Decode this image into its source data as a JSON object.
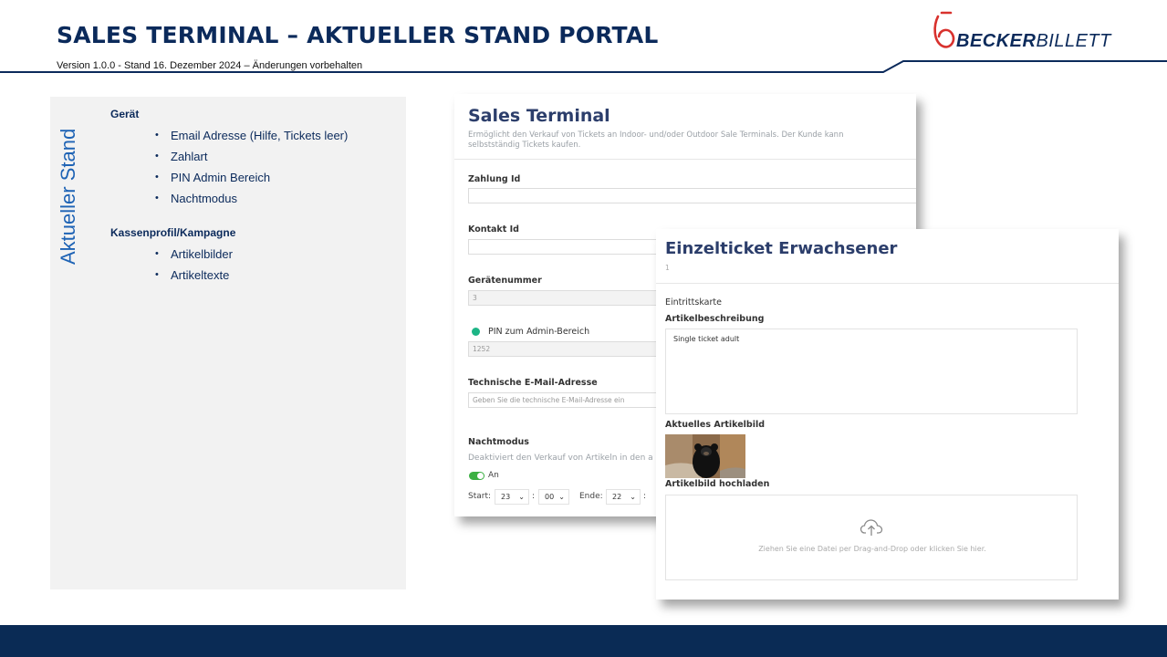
{
  "slide": {
    "title": "SALES TERMINAL – AKTUELLER STAND PORTAL",
    "subtitle": "Version 1.0.0 - Stand 16. Dezember 2024 – Änderungen vorbehalten",
    "logo": {
      "part1": "BECKER",
      "part2": "BILLETT"
    }
  },
  "panel": {
    "vertical_label": "Aktueller Stand",
    "groups": [
      {
        "title": "Gerät",
        "items": [
          "Email Adresse (Hilfe, Tickets leer)",
          "Zahlart",
          "PIN Admin Bereich",
          "Nachtmodus"
        ]
      },
      {
        "title": "Kassenprofil/Kampagne",
        "items": [
          "Artikelbilder",
          "Artikeltexte"
        ]
      }
    ]
  },
  "sales_terminal": {
    "title": "Sales Terminal",
    "description": "Ermöglicht den Verkauf von Tickets an Indoor- und/oder Outdoor Sale Terminals. Der Kunde kann selbstständig Tickets kaufen.",
    "zahlung_label": "Zahlung Id",
    "kontakt_label": "Kontakt Id",
    "geraet_label": "Gerätenummer",
    "geraet_value": "3",
    "pin_label": "PIN zum Admin-Bereich",
    "pin_value": "1252",
    "email_label": "Technische E-Mail-Adresse",
    "email_placeholder": "Geben Sie die technische E-Mail-Adresse ein",
    "night_label": "Nachtmodus",
    "night_desc": "Deaktiviert den Verkauf von Artikeln in den a",
    "toggle_label": "An",
    "start_label": "Start:",
    "start_hour": "23",
    "start_min": "00",
    "end_label": "Ende:",
    "end_hour": "22",
    "colon": ":"
  },
  "ticket": {
    "title": "Einzelticket Erwachsener",
    "id": "1",
    "category": "Eintrittskarte",
    "desc_label": "Artikelbeschreibung",
    "desc_value": "Single ticket adult",
    "image_label": "Aktuelles Artikelbild",
    "upload_label": "Artikelbild hochladen",
    "upload_text": "Ziehen Sie eine Datei per Drag-and-Drop oder klicken Sie hier."
  },
  "colors": {
    "navy": "#0b2a5b",
    "accent_red": "#d8322e",
    "panel_bg": "#f2f2f2",
    "footer": "#0a2b55",
    "green": "#1db586"
  }
}
